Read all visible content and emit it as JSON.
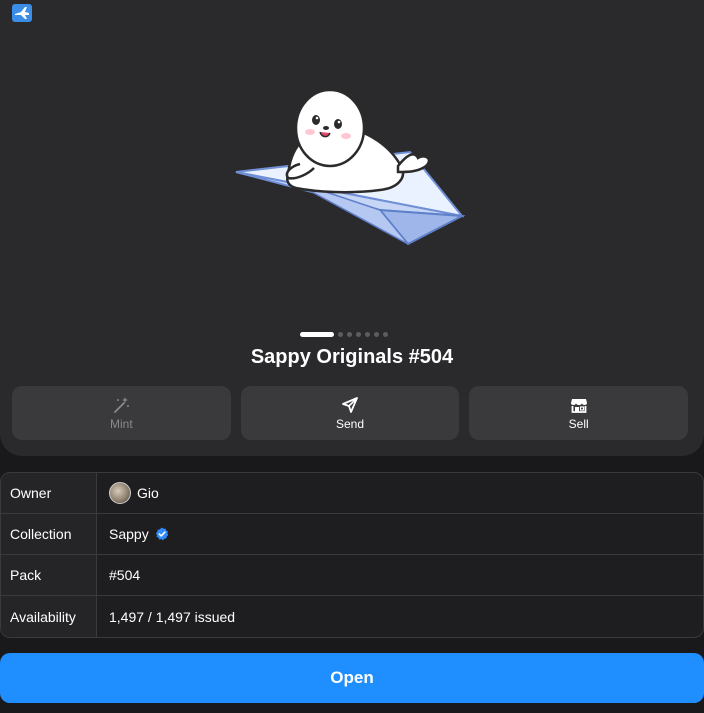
{
  "item": {
    "title": "Sappy Originals #504"
  },
  "carousel": {
    "dot_count": 7,
    "active_index": 0
  },
  "actions": [
    {
      "label": "Mint",
      "icon": "magic-wand-icon",
      "enabled": false
    },
    {
      "label": "Send",
      "icon": "send-icon",
      "enabled": true
    },
    {
      "label": "Sell",
      "icon": "store-icon",
      "enabled": true
    }
  ],
  "info": {
    "owner_label": "Owner",
    "owner_value": "Gio",
    "collection_label": "Collection",
    "collection_value": "Sappy",
    "pack_label": "Pack",
    "pack_value": "#504",
    "availability_label": "Availability",
    "availability_value": "1,497 / 1,497 issued"
  },
  "open_button": {
    "label": "Open"
  },
  "colors": {
    "accent": "#1f8fff",
    "verified": "#2f8cff",
    "card": "#2a2a2c",
    "background": "#19191b"
  }
}
